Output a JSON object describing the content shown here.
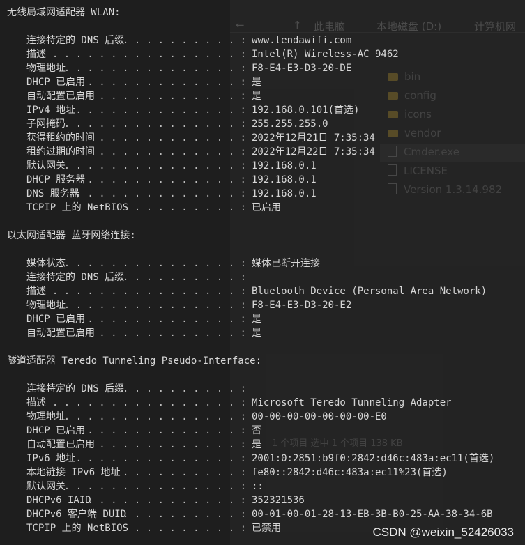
{
  "explorer_ghost": {
    "breadcrumb": [
      "此电脑",
      "本地磁盘 (D:)",
      "计算机网"
    ],
    "files": [
      {
        "name": "bin",
        "type": "folder"
      },
      {
        "name": "config",
        "type": "folder"
      },
      {
        "name": "icons",
        "type": "folder"
      },
      {
        "name": "vendor",
        "type": "folder"
      },
      {
        "name": "Cmder.exe",
        "type": "file"
      },
      {
        "name": "LICENSE",
        "type": "file"
      },
      {
        "name": "Version 1.3.14.982",
        "type": "file"
      }
    ],
    "status": "1 个项目    选中 1 个项目 138 KB"
  },
  "sections": [
    {
      "title": "无线局域网适配器 WLAN:",
      "rows": [
        {
          "label": "连接特定的 DNS 后缀",
          "value": "www.tendawifi.com"
        },
        {
          "label": "描述",
          "value": "Intel(R) Wireless-AC 9462"
        },
        {
          "label": "物理地址",
          "value": "F8-E4-E3-D3-20-DE"
        },
        {
          "label": "DHCP 已启用",
          "value": "是"
        },
        {
          "label": "自动配置已启用",
          "value": "是"
        },
        {
          "label": "IPv4 地址",
          "value": "192.168.0.101(首选)"
        },
        {
          "label": "子网掩码",
          "value": "255.255.255.0"
        },
        {
          "label": "获得租约的时间",
          "value": "2022年12月21日 7:35:34"
        },
        {
          "label": "租约过期的时间",
          "value": "2022年12月22日 7:35:34"
        },
        {
          "label": "默认网关",
          "value": "192.168.0.1"
        },
        {
          "label": "DHCP 服务器",
          "value": "192.168.0.1"
        },
        {
          "label": "DNS 服务器",
          "value": "192.168.0.1"
        },
        {
          "label": "TCPIP 上的 NetBIOS",
          "value": "已启用"
        }
      ]
    },
    {
      "title": "以太网适配器 蓝牙网络连接:",
      "rows": [
        {
          "label": "媒体状态",
          "value": "媒体已断开连接"
        },
        {
          "label": "连接特定的 DNS 后缀",
          "value": ""
        },
        {
          "label": "描述",
          "value": "Bluetooth Device (Personal Area Network)"
        },
        {
          "label": "物理地址",
          "value": "F8-E4-E3-D3-20-E2"
        },
        {
          "label": "DHCP 已启用",
          "value": "是"
        },
        {
          "label": "自动配置已启用",
          "value": "是"
        }
      ]
    },
    {
      "title": "隧道适配器 Teredo Tunneling Pseudo-Interface:",
      "rows": [
        {
          "label": "连接特定的 DNS 后缀",
          "value": ""
        },
        {
          "label": "描述",
          "value": "Microsoft Teredo Tunneling Adapter"
        },
        {
          "label": "物理地址",
          "value": "00-00-00-00-00-00-00-E0"
        },
        {
          "label": "DHCP 已启用",
          "value": "否"
        },
        {
          "label": "自动配置已启用",
          "value": "是"
        },
        {
          "label": "IPv6 地址",
          "value": "2001:0:2851:b9f0:2842:d46c:483a:ec11(首选)"
        },
        {
          "label": "本地链接 IPv6 地址",
          "value": "fe80::2842:d46c:483a:ec11%23(首选)"
        },
        {
          "label": "默认网关",
          "value": "::"
        },
        {
          "label": "DHCPv6 IAID",
          "value": "352321536"
        },
        {
          "label": "DHCPv6 客户端 DUID",
          "value": "00-01-00-01-28-13-EB-3B-B0-25-AA-38-34-6B"
        },
        {
          "label": "TCPIP 上的 NetBIOS",
          "value": "已禁用"
        }
      ]
    }
  ],
  "watermark": "CSDN @weixin_52426033"
}
